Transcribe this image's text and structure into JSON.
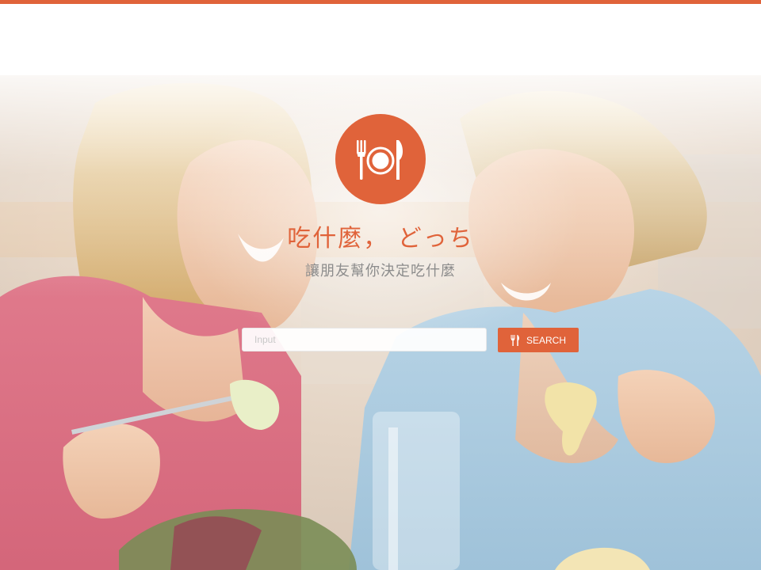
{
  "header": {
    "accent_color": "#e0633a"
  },
  "hero": {
    "logo_icon": "plate-fork-knife-icon",
    "title": "吃什麼， どっち",
    "subtitle": "讓朋友幫你決定吃什麼"
  },
  "search": {
    "placeholder": "Input",
    "value": "",
    "button_label": "SEARCH",
    "button_icon": "fork-knife-icon"
  }
}
